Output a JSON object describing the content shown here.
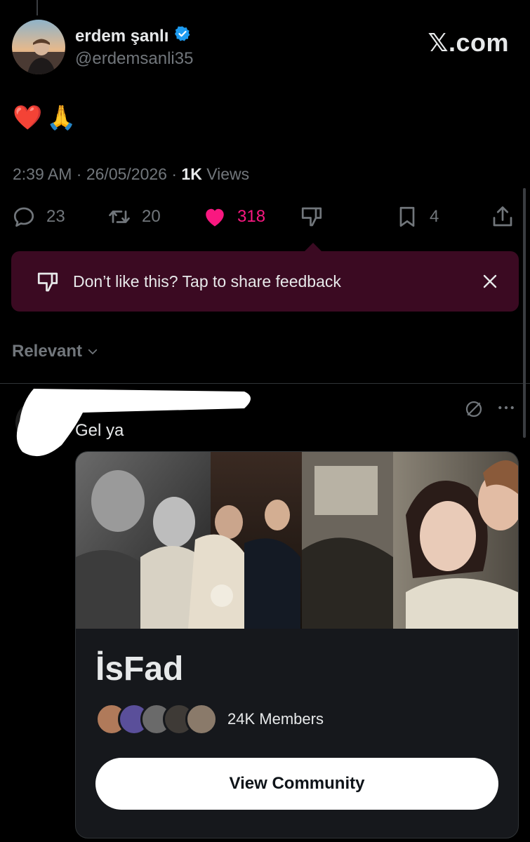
{
  "colors": {
    "background": "#000000",
    "text": "#e7e9ea",
    "muted": "#71767b",
    "like": "#f91880",
    "feedback_bg": "#3b0a22",
    "verified": "#1d9bf0"
  },
  "post": {
    "author_name": "erdem şanlı",
    "handle": "@erdemsanli35",
    "verified": true,
    "body_emojis": [
      "❤️",
      "🙏"
    ],
    "time": "2:39 AM",
    "date": "26/05/2026",
    "views_count": "1K",
    "views_label": " Views",
    "separator": " · "
  },
  "watermark": "𝕏.com",
  "actions": {
    "replies": "23",
    "reposts": "20",
    "likes": "318",
    "bookmarks": "4"
  },
  "feedback": {
    "text": "Don’t like this? Tap to share feedback"
  },
  "sort": {
    "label": "Relevant"
  },
  "reply": {
    "text": "Gel ya"
  },
  "community": {
    "name": "İsFad",
    "members": "24K Members",
    "button_label": "View Community"
  }
}
